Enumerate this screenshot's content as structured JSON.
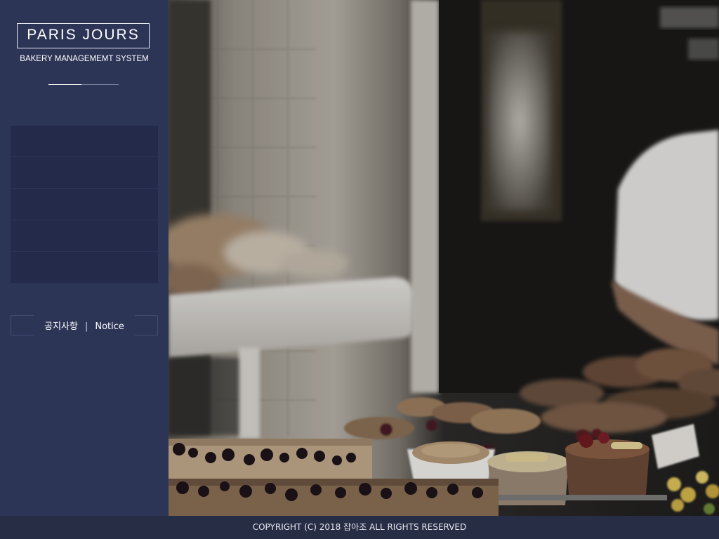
{
  "brand": {
    "title": "PARIS JOURS",
    "subtitle": "BAKERY MANAGEMEMT SYSTEM"
  },
  "menu": {
    "items": [
      "",
      "",
      "",
      "",
      ""
    ]
  },
  "notice": {
    "korean": "공지사항",
    "separator": "|",
    "english": "Notice"
  },
  "footer": {
    "copyright": "COPYRIGHT (C) 2018 잡아조 ALL RIGHTS RESERVED"
  },
  "colors": {
    "sidebar_bg": "#2d3557",
    "menu_item_bg": "#242b4a",
    "footer_bg": "#272d45",
    "text": "#ffffff"
  }
}
